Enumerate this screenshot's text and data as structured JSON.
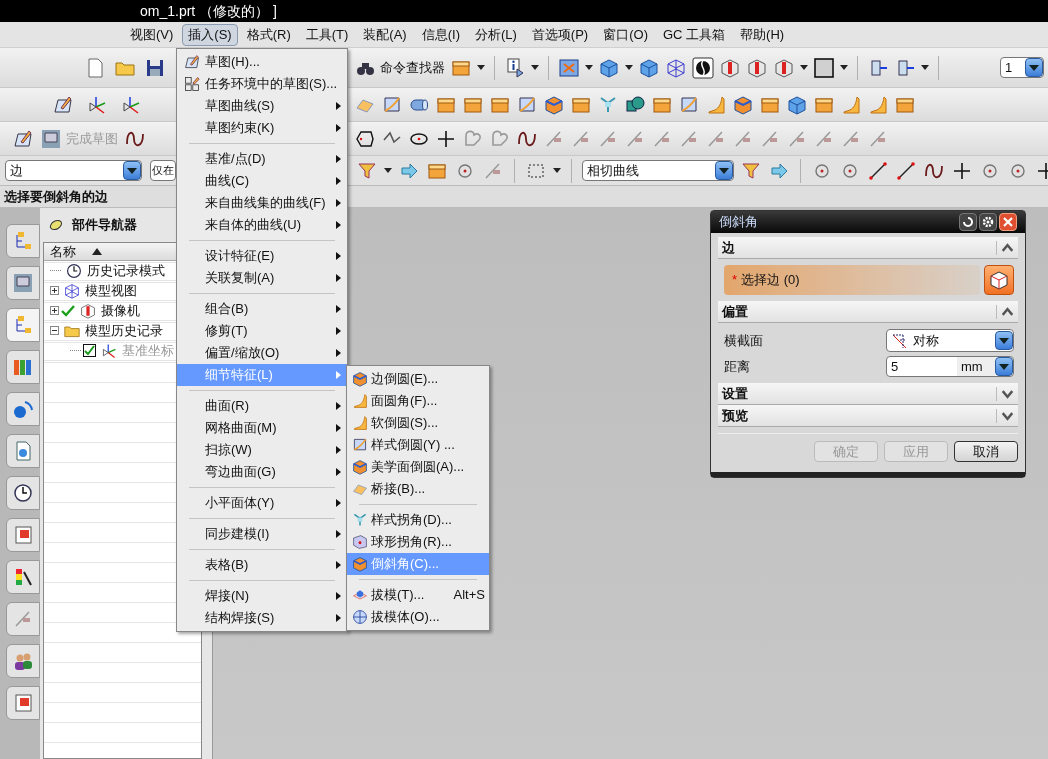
{
  "window": {
    "title": "om_1.prt （修改的） ]"
  },
  "menu_bar": [
    {
      "label": "视图(V)",
      "selected": false
    },
    {
      "label": "插入(S)",
      "selected": true
    },
    {
      "label": "格式(R)",
      "selected": false
    },
    {
      "label": "工具(T)",
      "selected": false
    },
    {
      "label": "装配(A)",
      "selected": false
    },
    {
      "label": "信息(I)",
      "selected": false
    },
    {
      "label": "分析(L)",
      "selected": false
    },
    {
      "label": "首选项(P)",
      "selected": false
    },
    {
      "label": "窗口(O)",
      "selected": false
    },
    {
      "label": "GC 工具箱",
      "selected": false
    },
    {
      "label": "帮助(H)",
      "selected": false
    }
  ],
  "toolbar": {
    "command_finder": "命令查找器",
    "finish_sketch": "完成草图",
    "layer": "1"
  },
  "selection_bar": {
    "type_filter": "边",
    "scope": "仅在",
    "curve_rule": "相切曲线"
  },
  "prompt": "选择要倒斜角的边",
  "navigator": {
    "title": "部件导航器",
    "column": "名称",
    "tree": [
      {
        "label": "历史记录模式",
        "disabled": false
      },
      {
        "label": "模型视图",
        "expanded": false,
        "disabled": false
      },
      {
        "label": "摄像机",
        "expanded": false,
        "disabled": false
      },
      {
        "label": "模型历史记录",
        "expanded": true,
        "disabled": false,
        "children": [
          {
            "label": "基准坐标",
            "checked": true,
            "disabled": true
          }
        ]
      }
    ]
  },
  "insert_menu": [
    [
      {
        "label": "草图(H)...",
        "submenu": false,
        "selected": false
      },
      {
        "label": "任务环境中的草图(S)...",
        "submenu": false,
        "selected": false
      },
      {
        "label": "草图曲线(S)",
        "submenu": true,
        "selected": false
      },
      {
        "label": "草图约束(K)",
        "submenu": true,
        "selected": false
      }
    ],
    [
      {
        "label": "基准/点(D)",
        "submenu": true,
        "selected": false
      },
      {
        "label": "曲线(C)",
        "submenu": true,
        "selected": false
      },
      {
        "label": "来自曲线集的曲线(F)",
        "submenu": true,
        "selected": false
      },
      {
        "label": "来自体的曲线(U)",
        "submenu": true,
        "selected": false
      }
    ],
    [
      {
        "label": "设计特征(E)",
        "submenu": true,
        "selected": false
      },
      {
        "label": "关联复制(A)",
        "submenu": true,
        "selected": false
      }
    ],
    [
      {
        "label": "组合(B)",
        "submenu": true,
        "selected": false
      },
      {
        "label": "修剪(T)",
        "submenu": true,
        "selected": false
      },
      {
        "label": "偏置/缩放(O)",
        "submenu": true,
        "selected": false
      },
      {
        "label": "细节特征(L)",
        "submenu": true,
        "selected": true
      }
    ],
    [
      {
        "label": "曲面(R)",
        "submenu": true,
        "selected": false
      },
      {
        "label": "网格曲面(M)",
        "submenu": true,
        "selected": false
      },
      {
        "label": "扫掠(W)",
        "submenu": true,
        "selected": false
      },
      {
        "label": "弯边曲面(G)",
        "submenu": true,
        "selected": false
      }
    ],
    [
      {
        "label": "小平面体(Y)",
        "submenu": true,
        "selected": false
      }
    ],
    [
      {
        "label": "同步建模(I)",
        "submenu": true,
        "selected": false
      }
    ],
    [
      {
        "label": "表格(B)",
        "submenu": true,
        "selected": false
      }
    ],
    [
      {
        "label": "焊接(N)",
        "submenu": true,
        "selected": false
      },
      {
        "label": "结构焊接(S)",
        "submenu": true,
        "selected": false
      }
    ]
  ],
  "detail_submenu": [
    [
      {
        "label": "边倒圆(E)...",
        "selected": false
      },
      {
        "label": "面圆角(F)...",
        "selected": false
      },
      {
        "label": "软倒圆(S)...",
        "selected": false
      },
      {
        "label": "样式倒圆(Y) ...",
        "selected": false
      },
      {
        "label": "美学面倒圆(A)...",
        "selected": false
      },
      {
        "label": "桥接(B)...",
        "selected": false
      }
    ],
    [
      {
        "label": "样式拐角(D)...",
        "selected": false
      },
      {
        "label": "球形拐角(R)...",
        "selected": false
      },
      {
        "label": "倒斜角(C)...",
        "selected": true
      }
    ],
    [
      {
        "label": "拔模(T)...",
        "shortcut": "Alt+S",
        "selected": false
      },
      {
        "label": "拔模体(O)...",
        "selected": false
      }
    ]
  ],
  "dialog": {
    "title": "倒斜角",
    "sections": [
      {
        "title": "边",
        "expanded": true,
        "kind": "select",
        "required_mark": "*",
        "label": "选择边 (0)"
      },
      {
        "title": "偏置",
        "expanded": true,
        "kind": "fields",
        "fields": [
          {
            "label": "横截面",
            "kind": "dropdown",
            "value": "对称"
          },
          {
            "label": "距离",
            "kind": "number",
            "value": "5",
            "unit": "mm"
          }
        ]
      },
      {
        "title": "设置",
        "expanded": false
      },
      {
        "title": "预览",
        "expanded": false
      }
    ],
    "buttons": [
      {
        "label": "确定",
        "disabled": true
      },
      {
        "label": "应用",
        "disabled": true
      },
      {
        "label": "取消",
        "disabled": false
      }
    ]
  }
}
